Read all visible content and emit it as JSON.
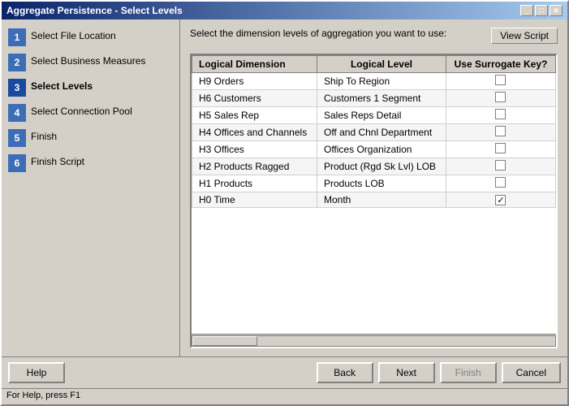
{
  "window": {
    "title": "Aggregate Persistence - Select Levels",
    "title_buttons": [
      "_",
      "□",
      "✕"
    ]
  },
  "instruction": "Select the dimension levels of aggregation you want to use:",
  "view_script_button": "View Script",
  "sidebar": {
    "steps": [
      {
        "number": "1",
        "label": "Select File Location",
        "state": "done"
      },
      {
        "number": "2",
        "label": "Select Business Measures",
        "state": "done"
      },
      {
        "number": "3",
        "label": "Select Levels",
        "state": "active"
      },
      {
        "number": "4",
        "label": "Select Connection Pool",
        "state": "pending"
      },
      {
        "number": "5",
        "label": "Finish",
        "state": "pending"
      },
      {
        "number": "6",
        "label": "Finish Script",
        "state": "pending"
      }
    ]
  },
  "table": {
    "columns": [
      "Logical Dimension",
      "Logical Level",
      "Use Surrogate Key?"
    ],
    "rows": [
      {
        "dimension": "H9 Orders",
        "level": "Ship To Region",
        "checked": false
      },
      {
        "dimension": "H6 Customers",
        "level": "Customers 1 Segment",
        "checked": false
      },
      {
        "dimension": "H5 Sales Rep",
        "level": "Sales Reps Detail",
        "checked": false
      },
      {
        "dimension": "H4 Offices and Channels",
        "level": "Off and Chnl Department",
        "checked": false
      },
      {
        "dimension": "H3 Offices",
        "level": "Offices Organization",
        "checked": false
      },
      {
        "dimension": "H2 Products Ragged",
        "level": "Product (Rgd Sk Lvl) LOB",
        "checked": false
      },
      {
        "dimension": "H1 Products",
        "level": "Products LOB",
        "checked": false
      },
      {
        "dimension": "H0 Time",
        "level": "Month",
        "checked": true
      }
    ]
  },
  "buttons": {
    "help": "Help",
    "back": "Back",
    "next": "Next",
    "finish": "Finish",
    "cancel": "Cancel"
  },
  "status_bar": "For Help, press F1"
}
